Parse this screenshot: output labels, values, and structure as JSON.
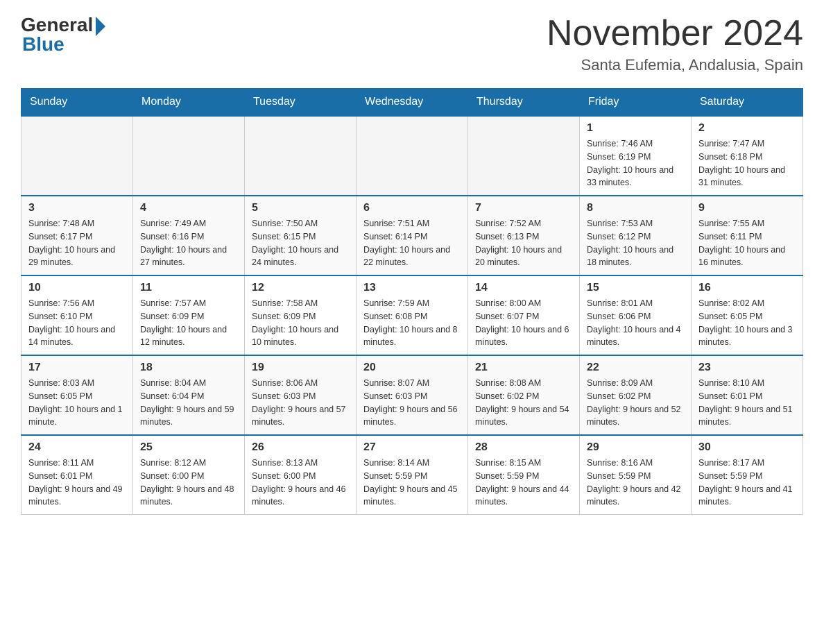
{
  "logo": {
    "general": "General",
    "blue": "Blue"
  },
  "title": "November 2024",
  "location": "Santa Eufemia, Andalusia, Spain",
  "days_of_week": [
    "Sunday",
    "Monday",
    "Tuesday",
    "Wednesday",
    "Thursday",
    "Friday",
    "Saturday"
  ],
  "weeks": [
    [
      {
        "day": "",
        "info": ""
      },
      {
        "day": "",
        "info": ""
      },
      {
        "day": "",
        "info": ""
      },
      {
        "day": "",
        "info": ""
      },
      {
        "day": "",
        "info": ""
      },
      {
        "day": "1",
        "info": "Sunrise: 7:46 AM\nSunset: 6:19 PM\nDaylight: 10 hours and 33 minutes."
      },
      {
        "day": "2",
        "info": "Sunrise: 7:47 AM\nSunset: 6:18 PM\nDaylight: 10 hours and 31 minutes."
      }
    ],
    [
      {
        "day": "3",
        "info": "Sunrise: 7:48 AM\nSunset: 6:17 PM\nDaylight: 10 hours and 29 minutes."
      },
      {
        "day": "4",
        "info": "Sunrise: 7:49 AM\nSunset: 6:16 PM\nDaylight: 10 hours and 27 minutes."
      },
      {
        "day": "5",
        "info": "Sunrise: 7:50 AM\nSunset: 6:15 PM\nDaylight: 10 hours and 24 minutes."
      },
      {
        "day": "6",
        "info": "Sunrise: 7:51 AM\nSunset: 6:14 PM\nDaylight: 10 hours and 22 minutes."
      },
      {
        "day": "7",
        "info": "Sunrise: 7:52 AM\nSunset: 6:13 PM\nDaylight: 10 hours and 20 minutes."
      },
      {
        "day": "8",
        "info": "Sunrise: 7:53 AM\nSunset: 6:12 PM\nDaylight: 10 hours and 18 minutes."
      },
      {
        "day": "9",
        "info": "Sunrise: 7:55 AM\nSunset: 6:11 PM\nDaylight: 10 hours and 16 minutes."
      }
    ],
    [
      {
        "day": "10",
        "info": "Sunrise: 7:56 AM\nSunset: 6:10 PM\nDaylight: 10 hours and 14 minutes."
      },
      {
        "day": "11",
        "info": "Sunrise: 7:57 AM\nSunset: 6:09 PM\nDaylight: 10 hours and 12 minutes."
      },
      {
        "day": "12",
        "info": "Sunrise: 7:58 AM\nSunset: 6:09 PM\nDaylight: 10 hours and 10 minutes."
      },
      {
        "day": "13",
        "info": "Sunrise: 7:59 AM\nSunset: 6:08 PM\nDaylight: 10 hours and 8 minutes."
      },
      {
        "day": "14",
        "info": "Sunrise: 8:00 AM\nSunset: 6:07 PM\nDaylight: 10 hours and 6 minutes."
      },
      {
        "day": "15",
        "info": "Sunrise: 8:01 AM\nSunset: 6:06 PM\nDaylight: 10 hours and 4 minutes."
      },
      {
        "day": "16",
        "info": "Sunrise: 8:02 AM\nSunset: 6:05 PM\nDaylight: 10 hours and 3 minutes."
      }
    ],
    [
      {
        "day": "17",
        "info": "Sunrise: 8:03 AM\nSunset: 6:05 PM\nDaylight: 10 hours and 1 minute."
      },
      {
        "day": "18",
        "info": "Sunrise: 8:04 AM\nSunset: 6:04 PM\nDaylight: 9 hours and 59 minutes."
      },
      {
        "day": "19",
        "info": "Sunrise: 8:06 AM\nSunset: 6:03 PM\nDaylight: 9 hours and 57 minutes."
      },
      {
        "day": "20",
        "info": "Sunrise: 8:07 AM\nSunset: 6:03 PM\nDaylight: 9 hours and 56 minutes."
      },
      {
        "day": "21",
        "info": "Sunrise: 8:08 AM\nSunset: 6:02 PM\nDaylight: 9 hours and 54 minutes."
      },
      {
        "day": "22",
        "info": "Sunrise: 8:09 AM\nSunset: 6:02 PM\nDaylight: 9 hours and 52 minutes."
      },
      {
        "day": "23",
        "info": "Sunrise: 8:10 AM\nSunset: 6:01 PM\nDaylight: 9 hours and 51 minutes."
      }
    ],
    [
      {
        "day": "24",
        "info": "Sunrise: 8:11 AM\nSunset: 6:01 PM\nDaylight: 9 hours and 49 minutes."
      },
      {
        "day": "25",
        "info": "Sunrise: 8:12 AM\nSunset: 6:00 PM\nDaylight: 9 hours and 48 minutes."
      },
      {
        "day": "26",
        "info": "Sunrise: 8:13 AM\nSunset: 6:00 PM\nDaylight: 9 hours and 46 minutes."
      },
      {
        "day": "27",
        "info": "Sunrise: 8:14 AM\nSunset: 5:59 PM\nDaylight: 9 hours and 45 minutes."
      },
      {
        "day": "28",
        "info": "Sunrise: 8:15 AM\nSunset: 5:59 PM\nDaylight: 9 hours and 44 minutes."
      },
      {
        "day": "29",
        "info": "Sunrise: 8:16 AM\nSunset: 5:59 PM\nDaylight: 9 hours and 42 minutes."
      },
      {
        "day": "30",
        "info": "Sunrise: 8:17 AM\nSunset: 5:59 PM\nDaylight: 9 hours and 41 minutes."
      }
    ]
  ]
}
